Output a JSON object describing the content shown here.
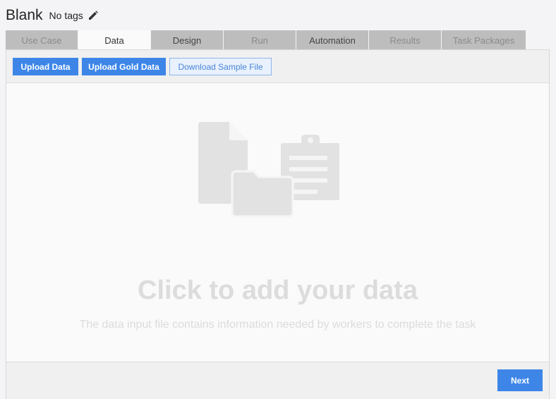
{
  "header": {
    "title": "Blank",
    "tags": "No tags"
  },
  "tabs": [
    {
      "label": "Use Case",
      "state": "disabled"
    },
    {
      "label": "Data",
      "state": "active"
    },
    {
      "label": "Design",
      "state": "enabled"
    },
    {
      "label": "Run",
      "state": "disabled"
    },
    {
      "label": "Automation",
      "state": "enabled"
    },
    {
      "label": "Results",
      "state": "disabled"
    },
    {
      "label": "Task Packages",
      "state": "disabled"
    }
  ],
  "toolbar": {
    "upload_data": "Upload Data",
    "upload_gold": "Upload Gold Data",
    "download_sample": "Download Sample File"
  },
  "dropzone": {
    "title": "Click to add your data",
    "subtitle": "The data input file contains information needed by workers to complete the task",
    "icon": "files-folder-clipboard-icon"
  },
  "footer": {
    "next_label": "Next"
  },
  "colors": {
    "accent": "#3d86e8",
    "tab_inactive": "#bdbdbd",
    "placeholder": "#dcdcdc"
  }
}
